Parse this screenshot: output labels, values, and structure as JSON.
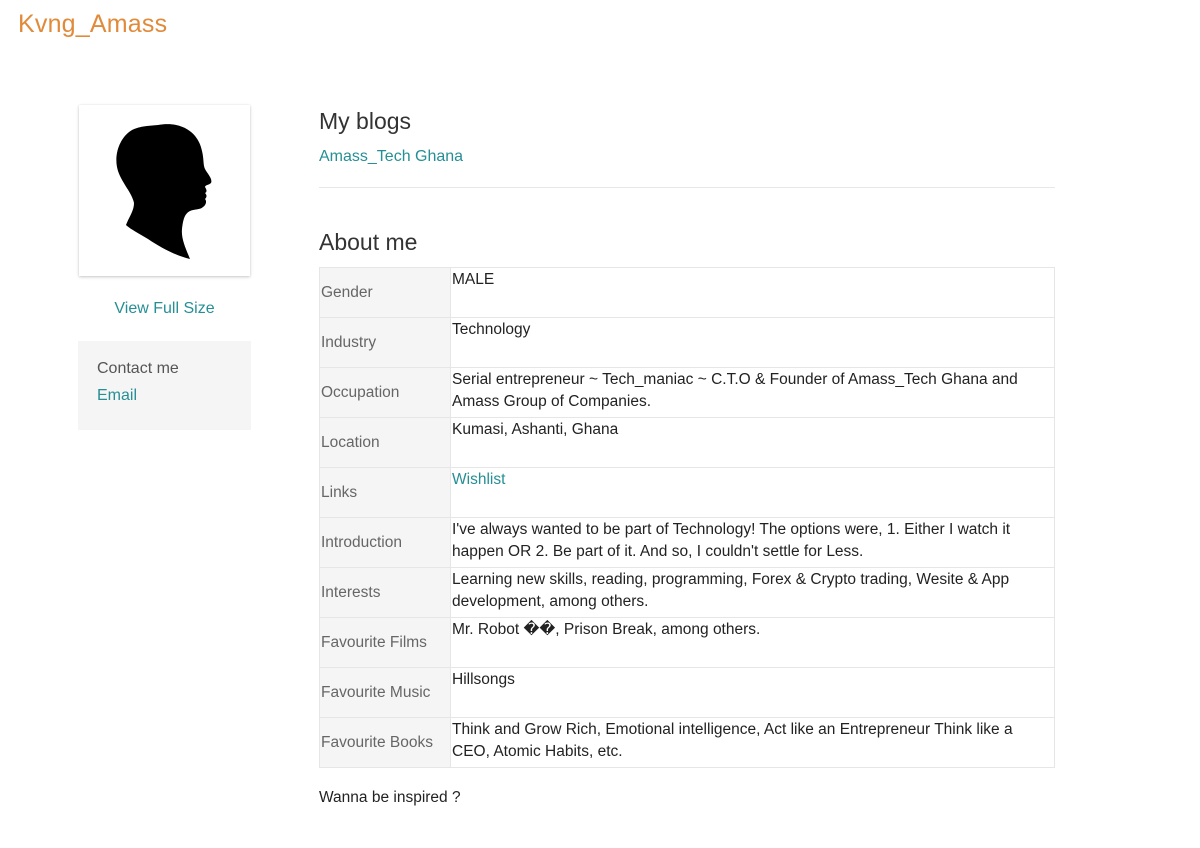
{
  "site": {
    "title": "Kvng_Amass"
  },
  "profile": {
    "photo_icon": "silhouette-head-icon",
    "view_full_size": "View Full Size"
  },
  "contact": {
    "heading": "Contact me",
    "email_label": "Email"
  },
  "blogs": {
    "heading": "My blogs",
    "items": [
      "Amass_Tech Ghana"
    ]
  },
  "about": {
    "heading": "About me",
    "rows": [
      {
        "label": "Gender",
        "value": "MALE"
      },
      {
        "label": "Industry",
        "value": "Technology"
      },
      {
        "label": "Occupation",
        "value": "Serial entrepreneur ~ Tech_maniac ~ C.T.O & Founder of Amass_Tech Ghana and Amass Group of Companies."
      },
      {
        "label": "Location",
        "value": "Kumasi, Ashanti, Ghana"
      },
      {
        "label": "Links",
        "value": "Wishlist"
      },
      {
        "label": "Introduction",
        "value": "I've always wanted to be part of Technology! The options were, 1. Either I watch it happen OR 2. Be part of it. And so, I couldn't settle for Less."
      },
      {
        "label": "Interests",
        "value": "Learning new skills, reading, programming, Forex & Crypto trading, Wesite & App development, among others."
      },
      {
        "label": "Favourite Films",
        "value": "Mr. Robot ��, Prison Break, among others."
      },
      {
        "label": "Favourite Music",
        "value": "Hillsongs"
      },
      {
        "label": "Favourite Books",
        "value": "Think and Grow Rich, Emotional intelligence, Act like an Entrepreneur Think like a CEO, Atomic Habits, etc."
      }
    ]
  },
  "footer_text": "Wanna be inspired ?",
  "colors": {
    "title": "#e08a3a",
    "link": "#258f95",
    "label_bg": "#f5f5f5"
  }
}
